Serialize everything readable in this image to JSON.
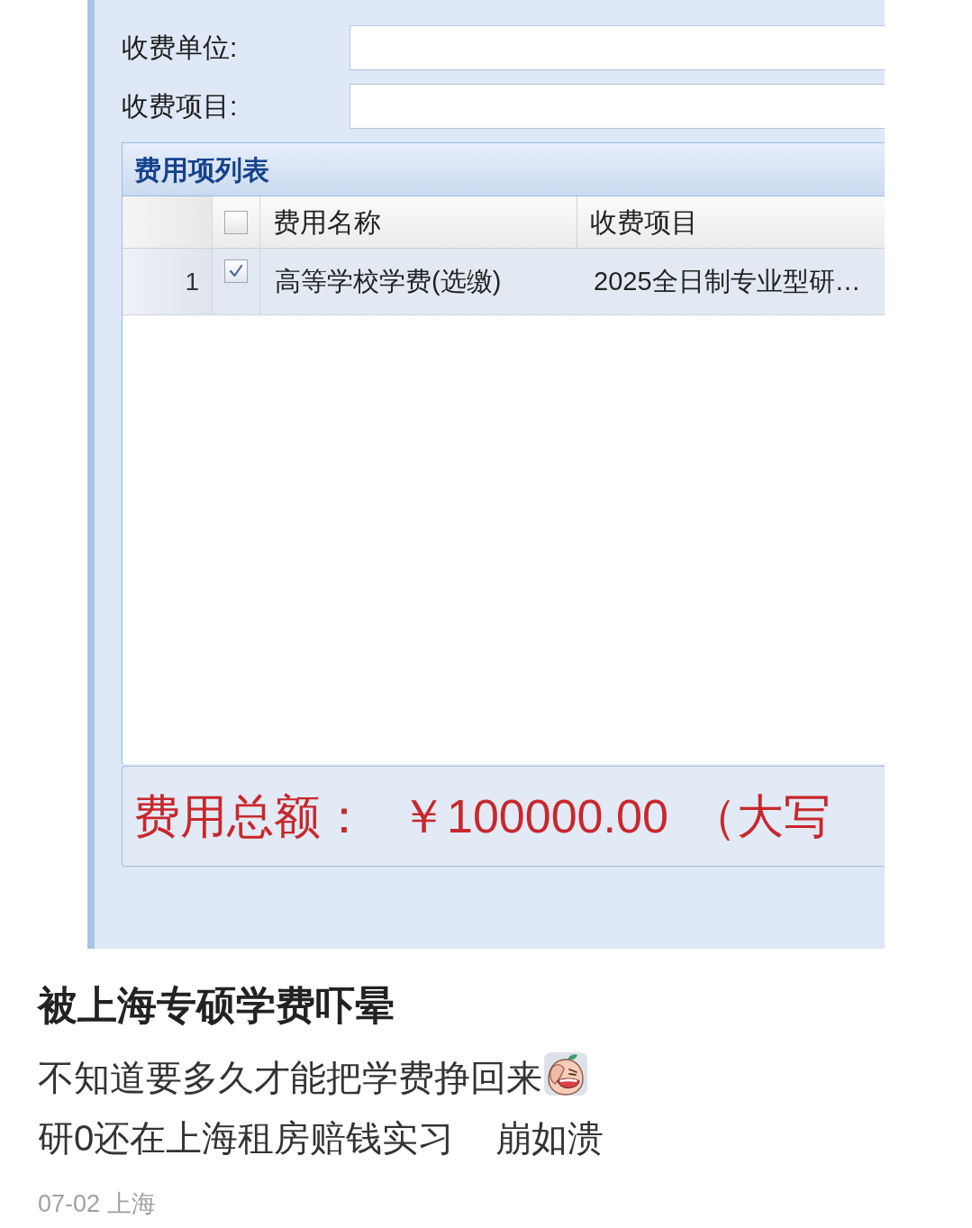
{
  "form": {
    "fields": [
      {
        "label": "收费单位:"
      },
      {
        "label": "收费项目:"
      }
    ],
    "fee_grid": {
      "title": "费用项列表",
      "header_checkbox": {
        "checked": false
      },
      "columns": [
        "费用名称",
        "收费项目"
      ],
      "rows": [
        {
          "number": "1",
          "checked": true,
          "cells": [
            "高等学校学费(选缴)",
            "2025全日制专业型研…"
          ]
        }
      ]
    },
    "total": {
      "label": "费用总额：",
      "amount": "￥100000.00",
      "note": "（大写"
    }
  },
  "post": {
    "title": "被上海专硕学费吓晕",
    "lines": [
      {
        "parts": [
          {
            "kind": "text",
            "text": "不知道要多久才能把学费挣回来"
          },
          {
            "kind": "emoji"
          }
        ]
      },
      {
        "parts": [
          {
            "kind": "text",
            "text": "研0还在上海租房赔钱实习"
          },
          {
            "kind": "text",
            "text": "崩如溃"
          }
        ]
      }
    ],
    "meta": "07-02 上海"
  }
}
